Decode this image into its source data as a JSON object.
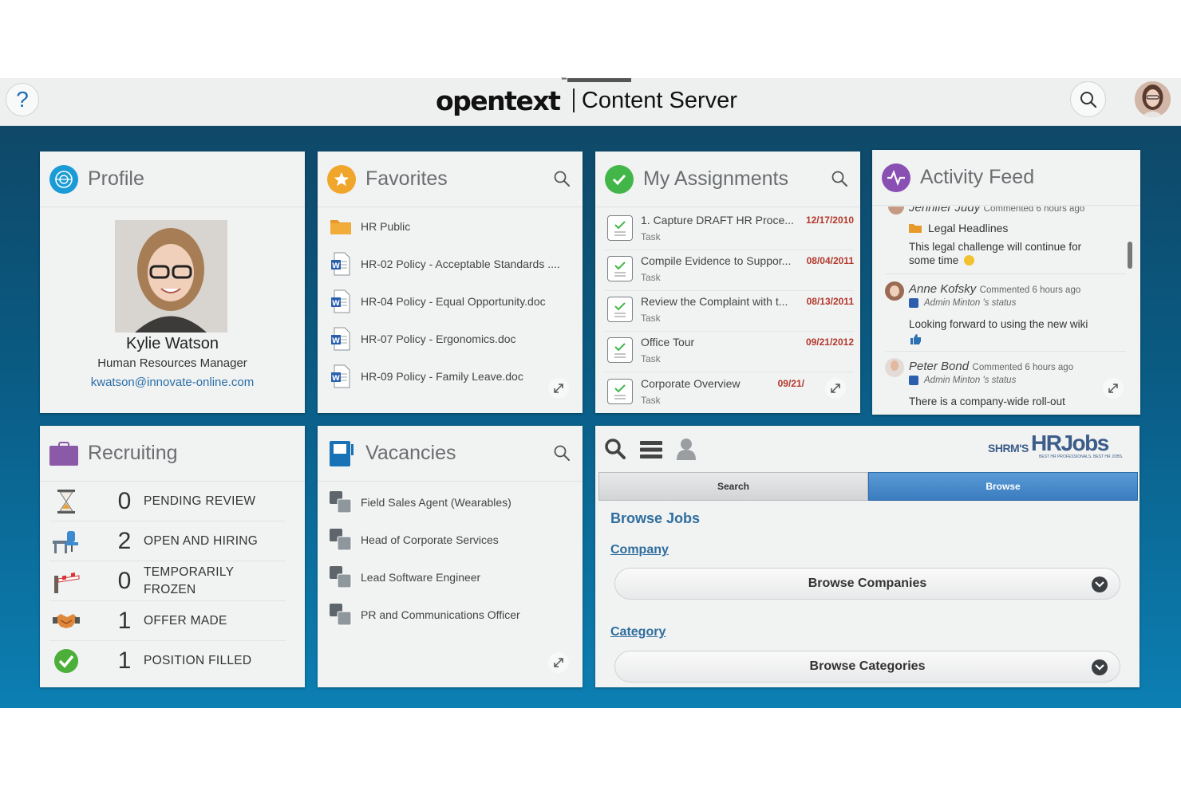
{
  "header": {
    "help_label": "?",
    "brand_logo": "opentext",
    "brand_tm": "™",
    "product_name": "Content Server"
  },
  "profile": {
    "title": "Profile",
    "name": "Kylie Watson",
    "role": "Human Resources Manager",
    "email": "kwatson@innovate-online.com"
  },
  "favorites": {
    "title": "Favorites",
    "items": [
      {
        "label": "HR Public",
        "icon": "folder-icon"
      },
      {
        "label": "HR-02 Policy - Acceptable Standards ....",
        "icon": "word-doc-icon"
      },
      {
        "label": "HR-04 Policy - Equal Opportunity.doc",
        "icon": "word-doc-icon"
      },
      {
        "label": "HR-07 Policy - Ergonomics.doc",
        "icon": "word-doc-icon"
      },
      {
        "label": "HR-09 Policy - Family Leave.doc",
        "icon": "word-doc-icon"
      }
    ]
  },
  "assignments": {
    "title": "My Assignments",
    "items": [
      {
        "name": "1. Capture DRAFT HR Proce...",
        "type": "Task",
        "date": "12/17/2010"
      },
      {
        "name": "Compile Evidence to Suppor...",
        "type": "Task",
        "date": "08/04/2011"
      },
      {
        "name": "Review the Complaint with t...",
        "type": "Task",
        "date": "08/13/2011"
      },
      {
        "name": "Office Tour",
        "type": "Task",
        "date": "09/21/2012"
      },
      {
        "name": "Corporate Overview",
        "type": "Task",
        "date": "09/21/"
      }
    ]
  },
  "activity": {
    "title": "Activity Feed",
    "entries": [
      {
        "author": "Jennifer Judy",
        "meta": "Commented 6 hours ago",
        "folder": "Legal Headlines",
        "text": "This legal challenge will continue for some time"
      },
      {
        "author": "Anne Kofsky",
        "meta": "Commented 6 hours ago",
        "status": "Admin Minton 's status",
        "text": "Looking forward to using the new wiki"
      },
      {
        "author": "Peter Bond",
        "meta": "Commented 6 hours ago",
        "status": "Admin Minton 's status",
        "text": "There is a company-wide roll-out"
      }
    ]
  },
  "recruiting": {
    "title": "Recruiting",
    "rows": [
      {
        "count": "0",
        "label": "PENDING REVIEW",
        "icon": "hourglass-icon"
      },
      {
        "count": "2",
        "label": "OPEN AND HIRING",
        "icon": "desk-chair-icon"
      },
      {
        "count": "0",
        "label": "TEMPORARILY FROZEN",
        "label_line1": "TEMPORARILY",
        "label_line2": "FROZEN",
        "icon": "barrier-icon"
      },
      {
        "count": "1",
        "label": "OFFER MADE",
        "icon": "handshake-icon"
      },
      {
        "count": "1",
        "label": "POSITION FILLED",
        "icon": "check-circle-icon"
      }
    ]
  },
  "vacancies": {
    "title": "Vacancies",
    "items": [
      {
        "label": "Field Sales Agent (Wearables)"
      },
      {
        "label": "Head of Corporate Services"
      },
      {
        "label": "Lead Software Engineer"
      },
      {
        "label": "PR and Communications Officer"
      }
    ]
  },
  "jobs": {
    "logo_prefix": "SHRM'S",
    "logo_main": "HRJobs",
    "logo_tagline": "BEST HR PROFESSIONALS. BEST HR JOBS.",
    "tabs": [
      "Search",
      "Browse"
    ],
    "active_tab": "Browse",
    "heading": "Browse Jobs",
    "company_link": "Company",
    "company_select": "Browse Companies",
    "category_link": "Category",
    "category_select": "Browse Categories"
  },
  "colors": {
    "accent_blue": "#2f6e9e",
    "date_red": "#b3382b",
    "profile_icon": "#1a9bd6",
    "favorites_icon": "#f0a52b",
    "assignments_icon": "#43b649",
    "activity_icon": "#8a4fb3",
    "recruiting_icon": "#8a5aa8",
    "vacancies_icon": "#1a72b6"
  }
}
